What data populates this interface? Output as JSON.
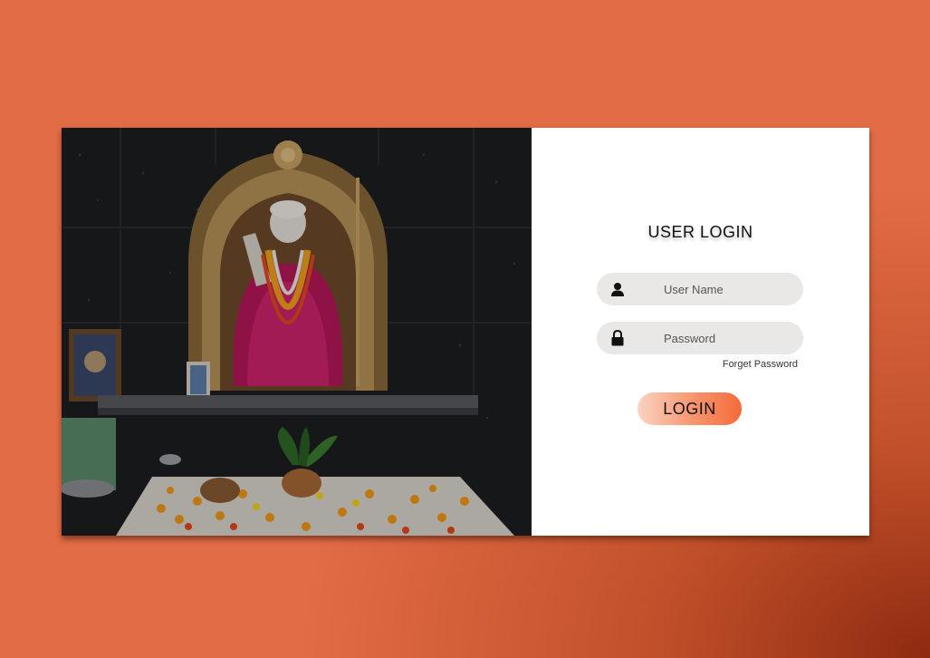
{
  "login": {
    "title": "USER LOGIN",
    "username_placeholder": "User Name",
    "password_placeholder": "Password",
    "forgot_label": "Forget Password",
    "login_label": "LOGIN"
  },
  "icons": {
    "username": "user-icon",
    "password": "lock-icon"
  },
  "colors": {
    "background": "#e26c45",
    "background_dark": "#8f2a10",
    "field_bg": "#e9e8e6",
    "button_start": "#fbd3c2",
    "button_end": "#f36a3a"
  }
}
